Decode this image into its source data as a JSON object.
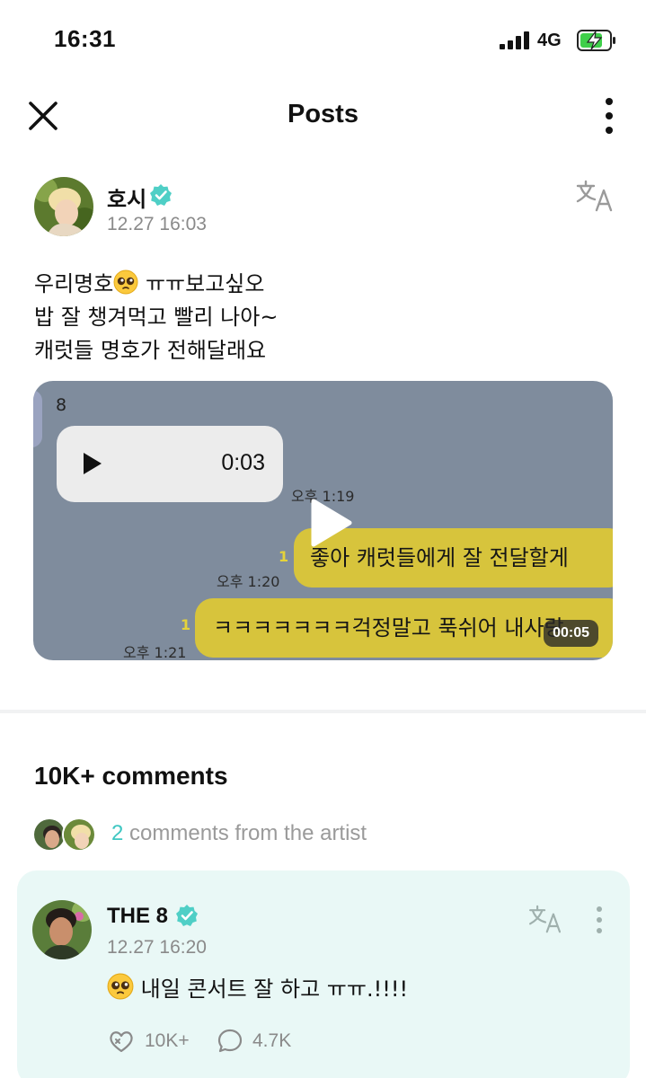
{
  "status_bar": {
    "time": "16:31",
    "network": "4G"
  },
  "header": {
    "title": "Posts"
  },
  "post": {
    "author": {
      "name": "호시",
      "verified": true
    },
    "timestamp": "12.27 16:03",
    "text_lines": [
      {
        "before_emoji": "우리명호",
        "emoji": "pleading-face-emoji",
        "after_emoji": " ㅠㅠ보고싶오"
      },
      {
        "text": "밥 잘 챙겨먹고 빨리 나아~"
      },
      {
        "text": "캐럿들 명호가 전해달래요"
      }
    ],
    "media": {
      "type": "video",
      "duration": "00:05",
      "chat": {
        "top_count": "8",
        "voice_message_duration": "0:03",
        "voice_time": "오후 1:19",
        "messages": [
          {
            "unread": "1",
            "time": "오후 1:20",
            "text": "좋아 캐럿들에게 잘 전달할게"
          },
          {
            "unread": "1",
            "time": "오후 1:21",
            "text": "ㅋㅋㅋㅋㅋㅋㅋ걱정말고 푹쉬어 내사랑"
          }
        ]
      }
    }
  },
  "comments": {
    "heading": "10K+ comments",
    "artist_comments": {
      "count": "2",
      "label": " comments from the artist"
    },
    "items": [
      {
        "author": "THE 8",
        "verified": true,
        "timestamp": "12.27 16:20",
        "text": "내일 콘서트 잘 하고 ㅠㅠ.!!!!",
        "emoji": "pleading-face-emoji",
        "likes": "10K+",
        "replies": "4.7K"
      }
    ]
  },
  "colors": {
    "accent": "#3fc7c2",
    "comment_card_bg": "#e9f8f6",
    "chat_bubble_yellow": "#d7c43c",
    "chat_bg": "#7f8c9d"
  }
}
